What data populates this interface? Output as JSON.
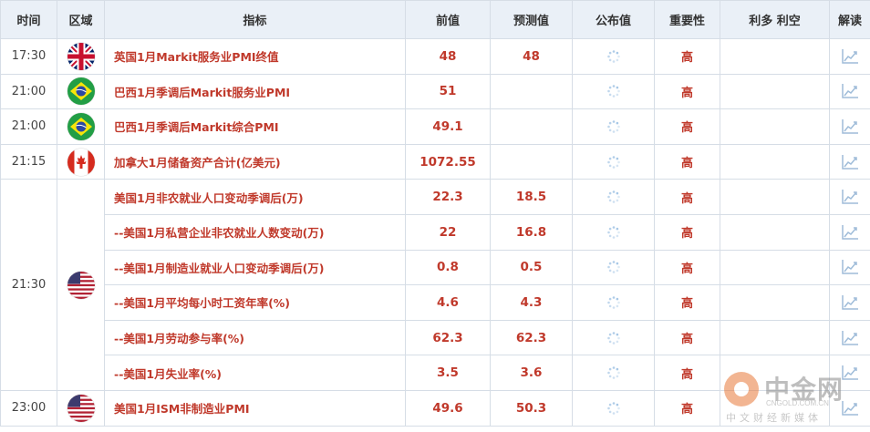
{
  "headers": {
    "time": "时间",
    "region": "区域",
    "indicator": "指标",
    "previous": "前值",
    "forecast": "预测值",
    "actual": "公布值",
    "importance": "重要性",
    "impact": "利多 利空",
    "analysis": "解读"
  },
  "colors": {
    "accent": "#c0392b",
    "header_bg": "#eaf0f7",
    "border": "#d6dde6"
  },
  "icons": {
    "actual": "loading-spinner-icon",
    "analysis": "chart-icon"
  },
  "rows": [
    {
      "time": "17:30",
      "flag": "uk",
      "indicator": "英国1月Markit服务业PMI终值",
      "previous": "48",
      "forecast": "48",
      "actual": "",
      "importance": "高"
    },
    {
      "time": "21:00",
      "flag": "brazil",
      "indicator": "巴西1月季调后Markit服务业PMI",
      "previous": "51",
      "forecast": "",
      "actual": "",
      "importance": "高"
    },
    {
      "time": "21:00",
      "flag": "brazil",
      "indicator": "巴西1月季调后Markit综合PMI",
      "previous": "49.1",
      "forecast": "",
      "actual": "",
      "importance": "高"
    },
    {
      "time": "21:15",
      "flag": "canada",
      "indicator": "加拿大1月储备资产合计(亿美元)",
      "previous": "1072.55",
      "forecast": "",
      "actual": "",
      "importance": "高"
    },
    {
      "time": "21:30",
      "flag": "usa",
      "indicator": "美国1月非农就业人口变动季调后(万)",
      "previous": "22.3",
      "forecast": "18.5",
      "actual": "",
      "importance": "高"
    },
    {
      "time": "",
      "flag": "",
      "indicator": "--美国1月私营企业非农就业人数变动(万)",
      "previous": "22",
      "forecast": "16.8",
      "actual": "",
      "importance": "高"
    },
    {
      "time": "",
      "flag": "",
      "indicator": "--美国1月制造业就业人口变动季调后(万)",
      "previous": "0.8",
      "forecast": "0.5",
      "actual": "",
      "importance": "高"
    },
    {
      "time": "",
      "flag": "",
      "indicator": "--美国1月平均每小时工资年率(%)",
      "previous": "4.6",
      "forecast": "4.3",
      "actual": "",
      "importance": "高"
    },
    {
      "time": "",
      "flag": "",
      "indicator": "--美国1月劳动参与率(%)",
      "previous": "62.3",
      "forecast": "62.3",
      "actual": "",
      "importance": "高"
    },
    {
      "time": "",
      "flag": "",
      "indicator": "--美国1月失业率(%)",
      "previous": "3.5",
      "forecast": "3.6",
      "actual": "",
      "importance": "高"
    },
    {
      "time": "23:00",
      "flag": "usa",
      "indicator": "美国1月ISM非制造业PMI",
      "previous": "49.6",
      "forecast": "50.3",
      "actual": "",
      "importance": "高"
    }
  ],
  "watermark": {
    "title": "中金网",
    "domain": "CNGOLD.COM.CN",
    "subtitle": "中文财经新媒体"
  }
}
